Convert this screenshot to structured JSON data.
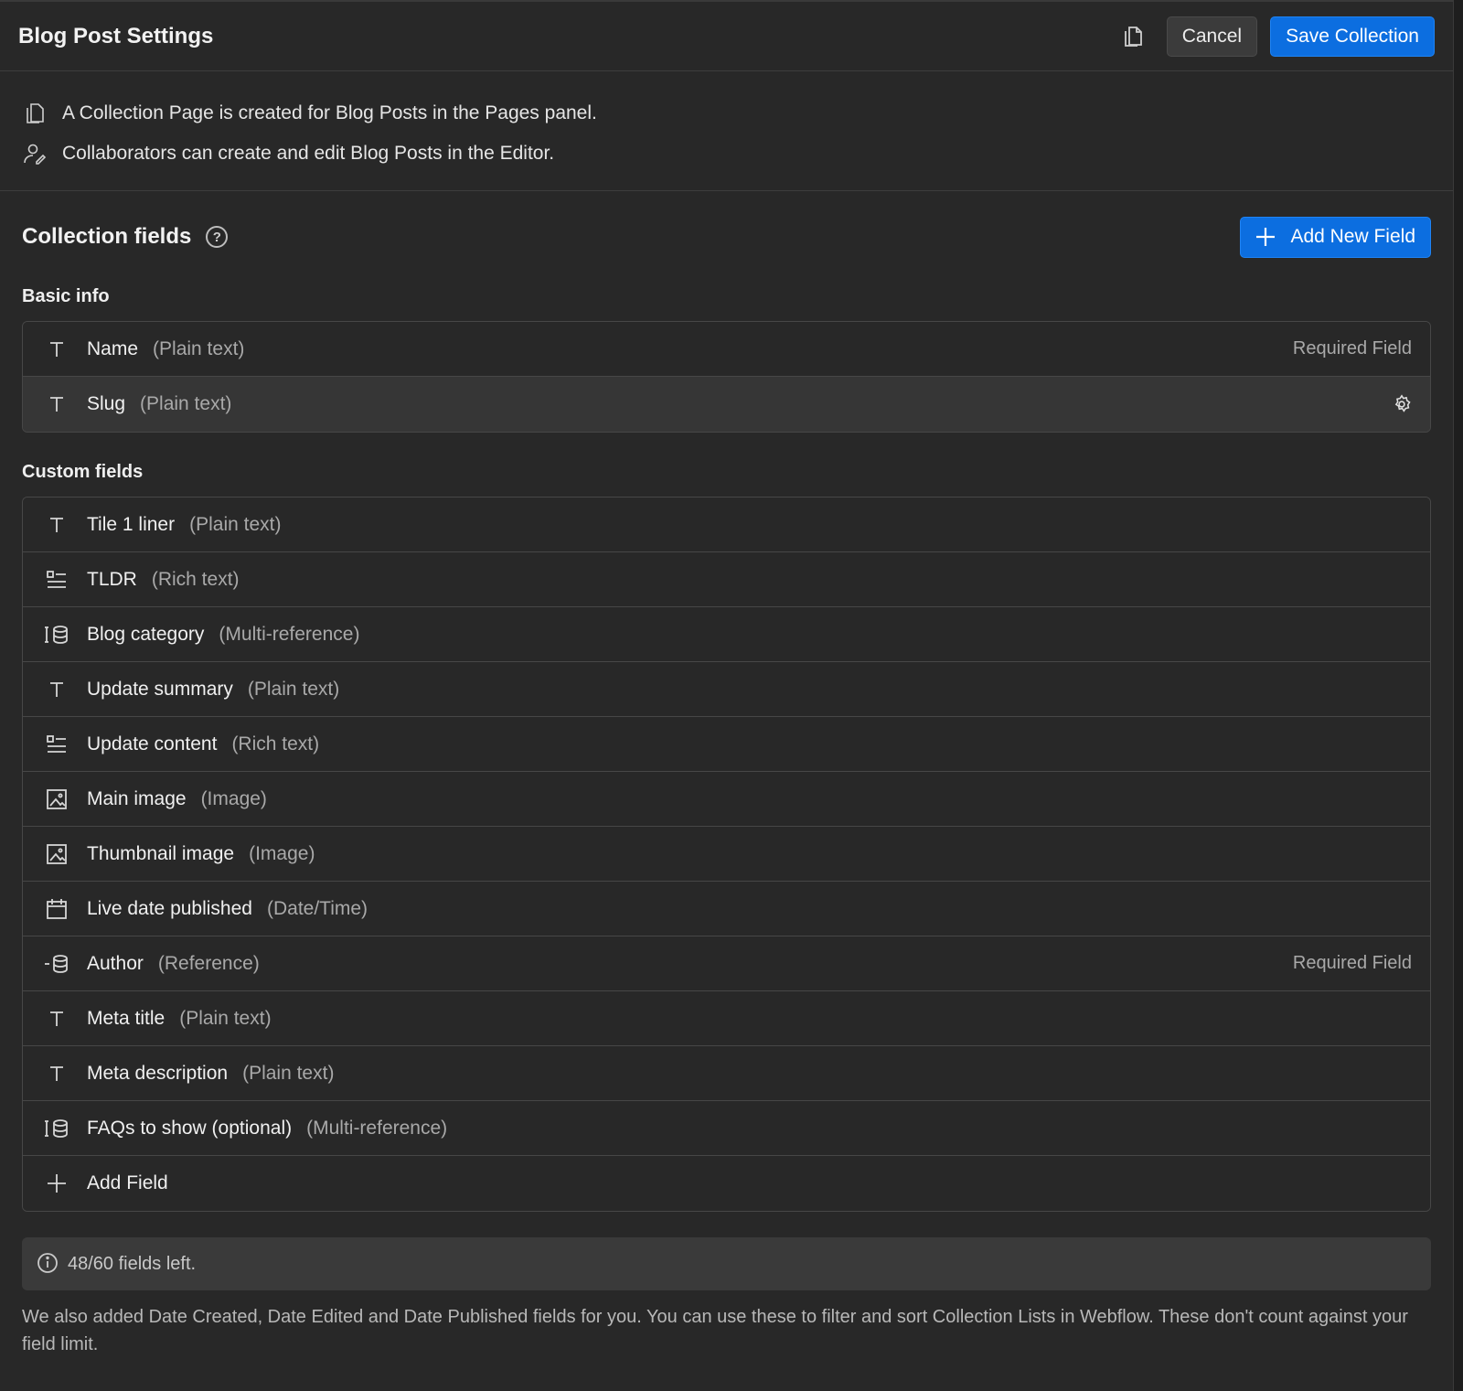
{
  "header": {
    "title": "Blog Post Settings",
    "cancel_label": "Cancel",
    "save_label": "Save Collection"
  },
  "info": {
    "line1": "A Collection Page is created for Blog Posts in the Pages panel.",
    "line2": "Collaborators can create and edit Blog Posts in the Editor."
  },
  "fields": {
    "heading": "Collection fields",
    "help_glyph": "?",
    "add_new_label": "Add New Field"
  },
  "basic": {
    "label": "Basic info",
    "rows": [
      {
        "name": "Name",
        "type": "(Plain text)",
        "note": "Required Field",
        "icon": "text-icon"
      },
      {
        "name": "Slug",
        "type": "(Plain text)",
        "note": "",
        "icon": "text-icon"
      }
    ]
  },
  "custom": {
    "label": "Custom fields",
    "rows": [
      {
        "name": "Tile 1 liner",
        "type": "(Plain text)",
        "note": "",
        "icon": "text-icon"
      },
      {
        "name": "TLDR",
        "type": "(Rich text)",
        "note": "",
        "icon": "rich-text-icon"
      },
      {
        "name": "Blog category",
        "type": "(Multi-reference)",
        "note": "",
        "icon": "multi-reference-icon"
      },
      {
        "name": "Update summary",
        "type": "(Plain text)",
        "note": "",
        "icon": "text-icon"
      },
      {
        "name": "Update content",
        "type": "(Rich text)",
        "note": "",
        "icon": "rich-text-icon"
      },
      {
        "name": "Main image",
        "type": "(Image)",
        "note": "",
        "icon": "image-icon"
      },
      {
        "name": "Thumbnail image",
        "type": "(Image)",
        "note": "",
        "icon": "image-icon"
      },
      {
        "name": "Live date published",
        "type": "(Date/Time)",
        "note": "",
        "icon": "calendar-icon"
      },
      {
        "name": "Author",
        "type": "(Reference)",
        "note": "Required Field",
        "icon": "reference-icon"
      },
      {
        "name": "Meta title",
        "type": "(Plain text)",
        "note": "",
        "icon": "text-icon"
      },
      {
        "name": "Meta description",
        "type": "(Plain text)",
        "note": "",
        "icon": "text-icon"
      },
      {
        "name": "FAQs to show (optional)",
        "type": "(Multi-reference)",
        "note": "",
        "icon": "multi-reference-icon"
      }
    ],
    "add_field_label": "Add Field"
  },
  "notice": "48/60 fields left.",
  "footer_text": "We also added Date Created, Date Edited and Date Published fields for you. You can use these to filter and sort Collection Lists in Webflow. These don't count against your field limit.",
  "colors": {
    "background": "#282828",
    "accent": "#0c6ee0",
    "text": "#f0f0f0",
    "muted": "#a9a9a9"
  }
}
